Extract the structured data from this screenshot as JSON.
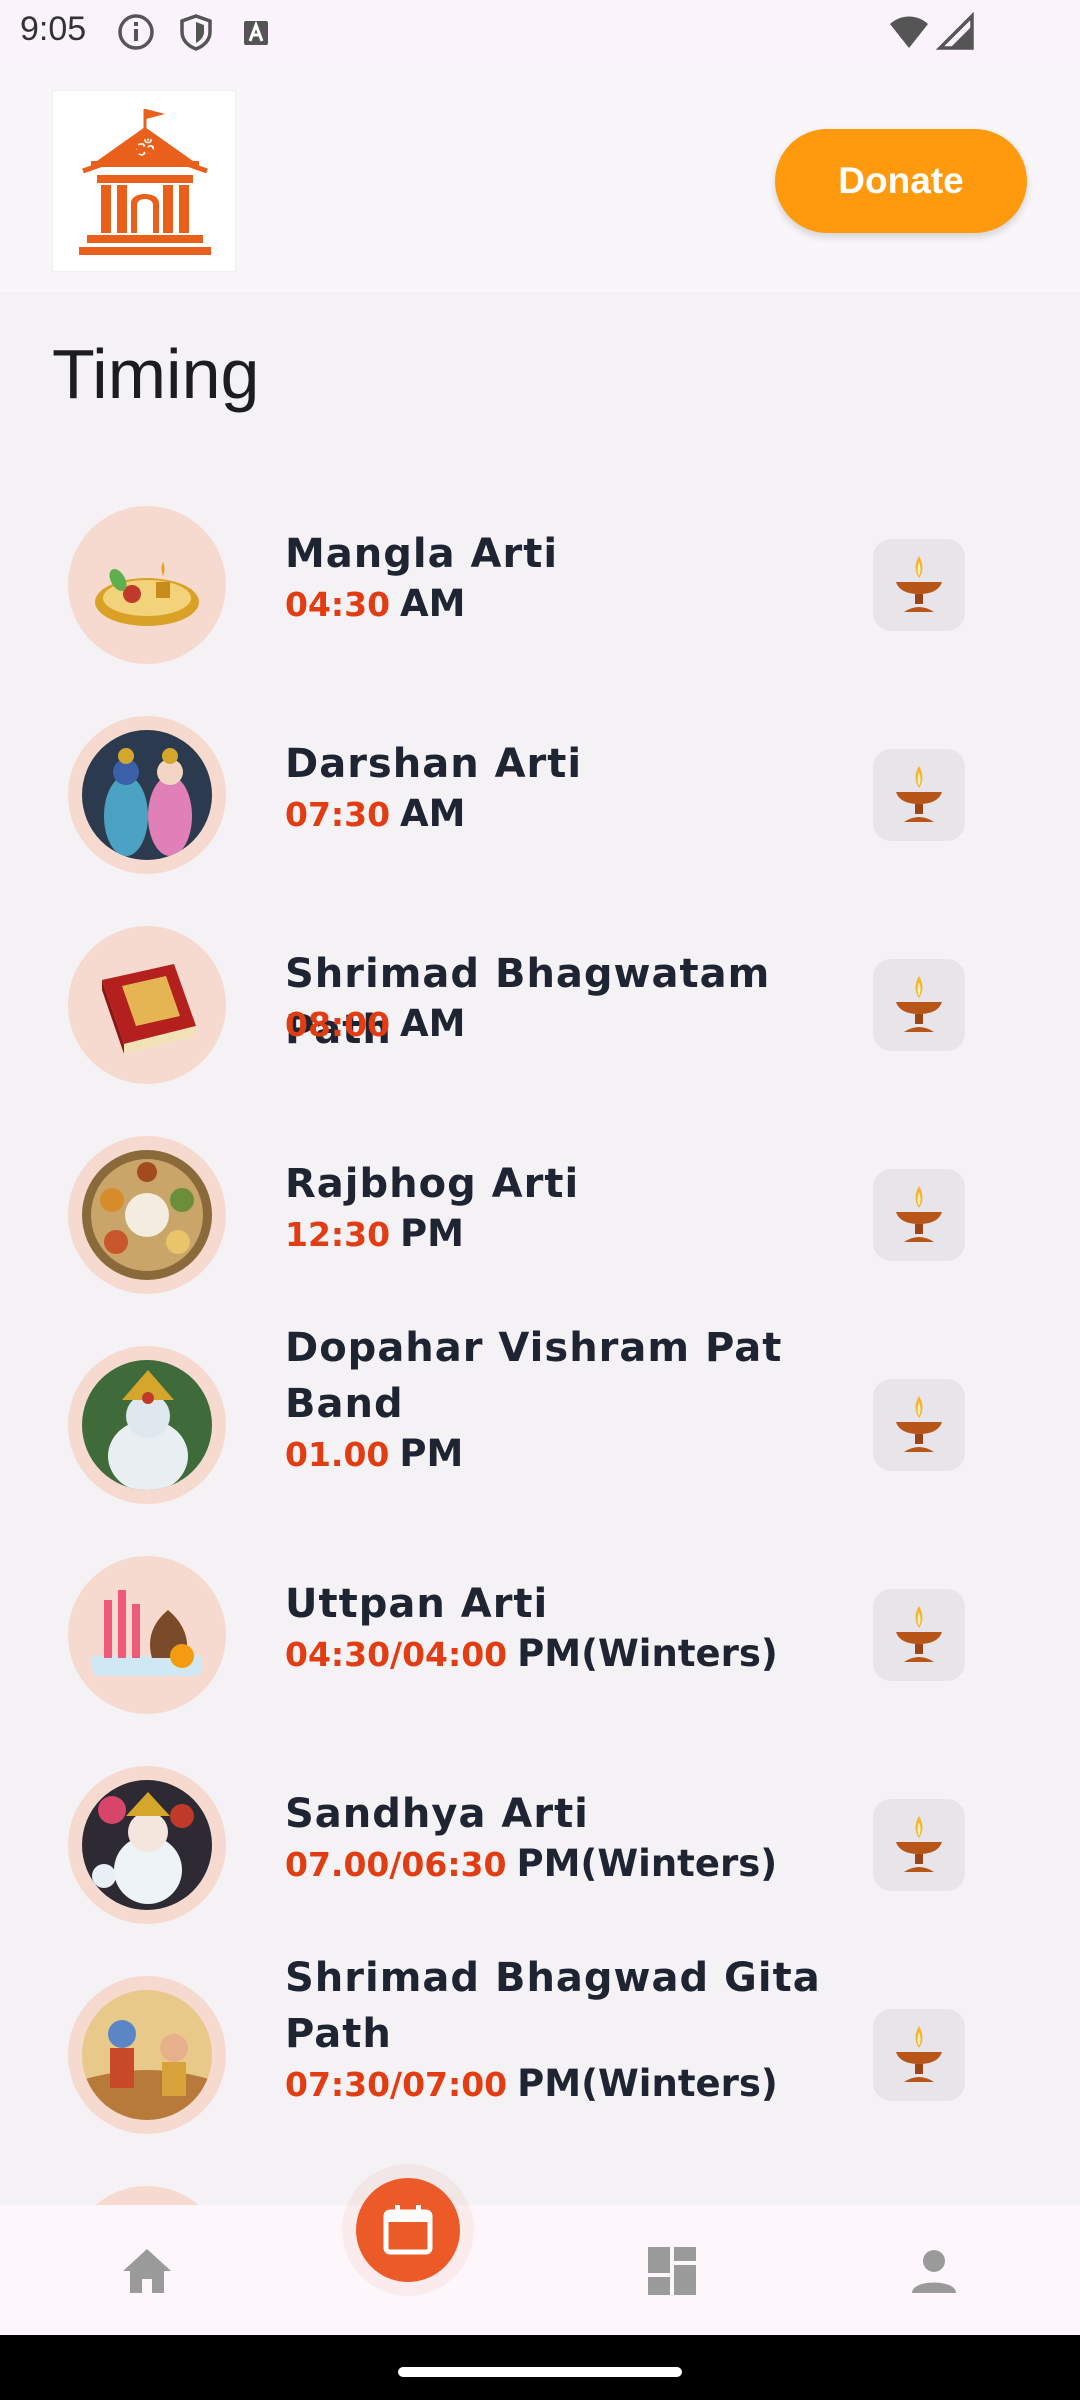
{
  "status_bar": {
    "time": "9:05"
  },
  "header": {
    "donate_label": "Donate"
  },
  "page": {
    "title": "Timing"
  },
  "items": [
    {
      "title": "Mangla Arti",
      "time": "04:30",
      "period": "AM"
    },
    {
      "title": "Darshan Arti",
      "time": "07:30",
      "period": "AM"
    },
    {
      "title": "Shrimad Bhagwatam Path",
      "time": "08:00",
      "period": "AM"
    },
    {
      "title": "Rajbhog Arti",
      "time": "12:30",
      "period": "PM"
    },
    {
      "title": "Dopahar Vishram Pat Band",
      "time": "01.00",
      "period": "PM"
    },
    {
      "title": "Uttpan Arti",
      "time": "04:30/04:00",
      "period": "PM(Winters)"
    },
    {
      "title": "Sandhya Arti",
      "time": "07.00/06:30",
      "period": "PM(Winters)"
    },
    {
      "title": "Shrimad Bhagwad Gita Path",
      "time": "07:30/07:00",
      "period": "PM(Winters)"
    }
  ],
  "nav": {
    "items": [
      "home-icon",
      "calendar-icon",
      "dashboard-icon",
      "profile-icon"
    ],
    "active": "calendar-icon"
  },
  "colors": {
    "accent_orange": "#ff9a0e",
    "fab_orange": "#ec5a28",
    "time_red": "#e23c12",
    "thumb_ring": "#f6d9cf"
  }
}
